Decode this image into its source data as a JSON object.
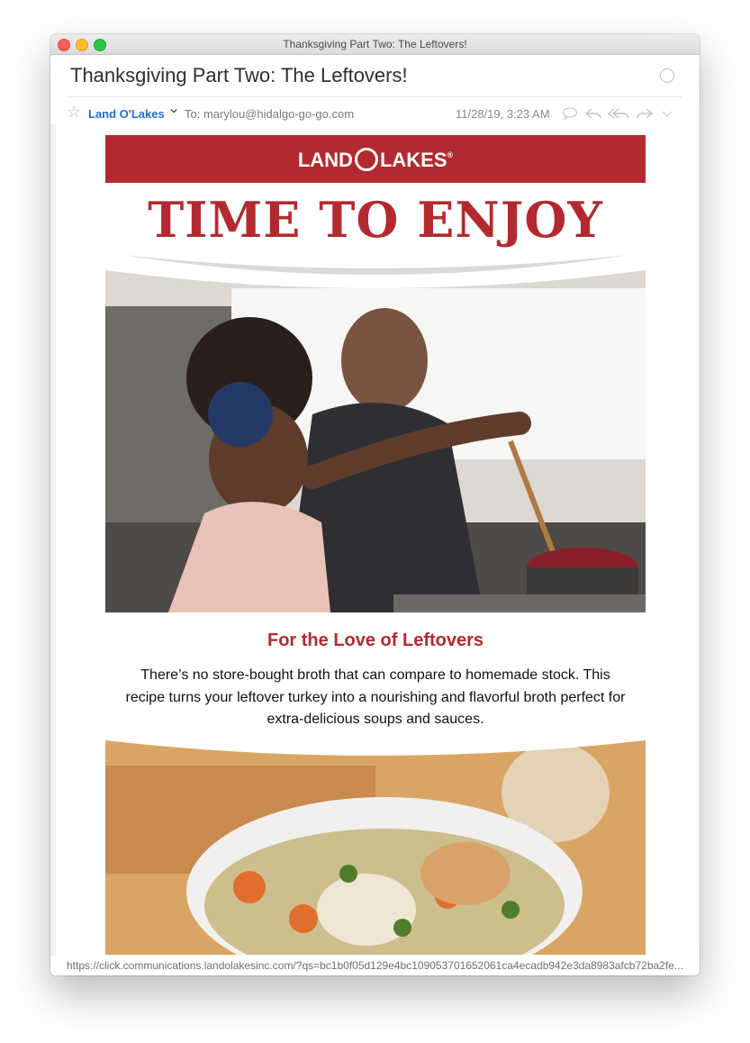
{
  "window": {
    "title": "Thanksgiving Part Two: The Leftovers!"
  },
  "message": {
    "subject": "Thanksgiving Part Two: The Leftovers!",
    "sender": "Land O'Lakes",
    "to": "To: marylou@hidalgo-go-go.com",
    "date": "11/28/19, 3:23 AM"
  },
  "email": {
    "brand_left": "LAND",
    "brand_right": "LAKES",
    "brand_mark": "®",
    "headline": "TIME TO ENJOY",
    "section_title": "For the Love of Leftovers",
    "body": "There’s no store-bought broth that can compare to homemade stock. This recipe turns your leftover turkey into a nourishing and flavorful broth perfect for extra-delicious soups and sauces."
  },
  "status": {
    "url": "https://click.communications.landolakesinc.com/?qs=bc1b0f05d129e4bc109053701652061ca4ecadb942e3da8983afcb72ba2fe..."
  },
  "icons": [
    "star-icon",
    "chevron-down-icon",
    "reply-icon",
    "reply-all-icon",
    "forward-icon",
    "chat-bubble-icon",
    "more-chevron-icon"
  ],
  "colors": {
    "brand_red": "#b22a2f",
    "link_blue": "#1e6fd9"
  }
}
